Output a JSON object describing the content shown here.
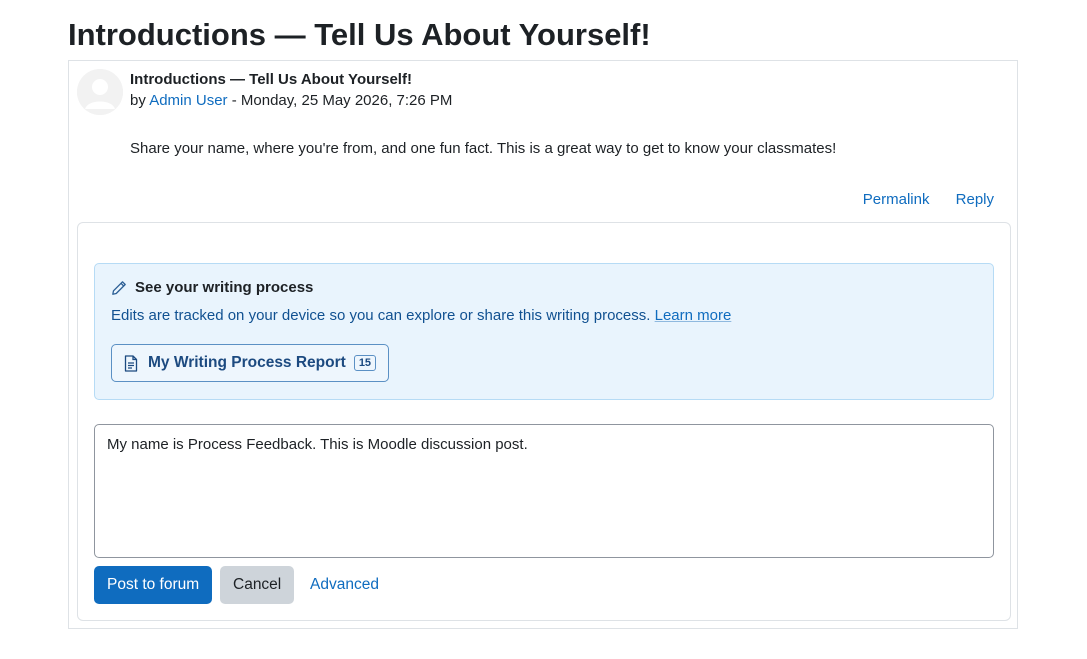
{
  "page": {
    "title": "Introductions — Tell Us About Yourself!"
  },
  "post": {
    "subject": "Introductions — Tell Us About Yourself!",
    "by_prefix": "by ",
    "author": "Admin User",
    "date_sep": " - ",
    "date": "Monday, 25 May 2026, 7:26 PM",
    "body": "Share your name, where you're from, and one fun fact. This is a great way to get to know your classmates!",
    "actions": {
      "permalink": "Permalink",
      "reply": "Reply"
    }
  },
  "writing_process": {
    "icon": "pencil-icon",
    "title": "See your writing process",
    "description": "Edits are tracked on your device so you can explore or share this writing process. ",
    "learn_more": "Learn more",
    "report_button": {
      "icon": "document-icon",
      "label": "My Writing Process Report",
      "count": "15"
    }
  },
  "reply_form": {
    "message": "My name is Process Feedback. This is Moodle discussion post.",
    "post_button": "Post to forum",
    "cancel_button": "Cancel",
    "advanced_link": "Advanced"
  },
  "colors": {
    "accent": "#0f6cbf",
    "panel_bg": "#e9f4fd",
    "secondary_button": "#ced4da"
  }
}
